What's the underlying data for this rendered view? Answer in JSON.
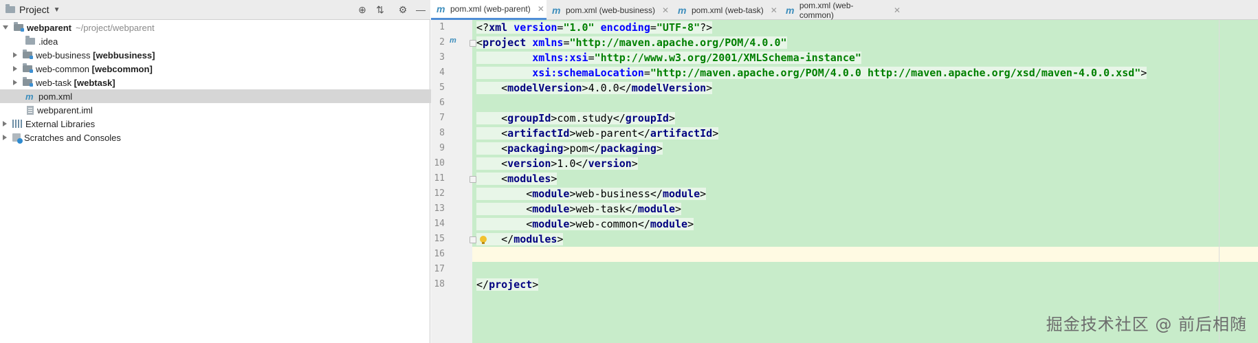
{
  "project": {
    "title": "Project",
    "tree": [
      {
        "name": "webparent",
        "path": "~/project/webparent"
      },
      {
        "name": ".idea"
      },
      {
        "name": "web-business",
        "module": "[webbusiness]"
      },
      {
        "name": "web-common",
        "module": "[webcommon]"
      },
      {
        "name": "web-task",
        "module": "[webtask]"
      },
      {
        "name": "pom.xml"
      },
      {
        "name": "webparent.iml"
      },
      {
        "name": "External Libraries"
      },
      {
        "name": "Scratches and Consoles"
      }
    ]
  },
  "tabs": [
    {
      "label": "pom.xml (web-parent)"
    },
    {
      "label": "pom.xml (web-business)"
    },
    {
      "label": "pom.xml (web-task)"
    },
    {
      "label": "pom.xml (web-common)"
    }
  ],
  "editor": {
    "line_numbers": [
      "1",
      "2",
      "3",
      "4",
      "5",
      "6",
      "7",
      "8",
      "9",
      "10",
      "11",
      "12",
      "13",
      "14",
      "15",
      "16",
      "17",
      "18"
    ],
    "lines": [
      "<?xml version=\"1.0\" encoding=\"UTF-8\"?>",
      "<project xmlns=\"http://maven.apache.org/POM/4.0.0\"",
      "         xmlns:xsi=\"http://www.w3.org/2001/XMLSchema-instance\"",
      "         xsi:schemaLocation=\"http://maven.apache.org/POM/4.0.0 http://maven.apache.org/xsd/maven-4.0.0.xsd\">",
      "    <modelVersion>4.0.0</modelVersion>",
      "",
      "    <groupId>com.study</groupId>",
      "    <artifactId>web-parent</artifactId>",
      "    <packaging>pom</packaging>",
      "    <version>1.0</version>",
      "    <modules>",
      "        <module>web-business</module>",
      "        <module>web-task</module>",
      "        <module>web-common</module>",
      "    </modules>",
      "",
      "",
      "</project>"
    ]
  },
  "watermark": "掘金技术社区 @ 前后相随",
  "colors": {
    "editor_bg": "#c8ecca",
    "current_line": "#fffae3",
    "tab_accent": "#4f8dd6"
  }
}
